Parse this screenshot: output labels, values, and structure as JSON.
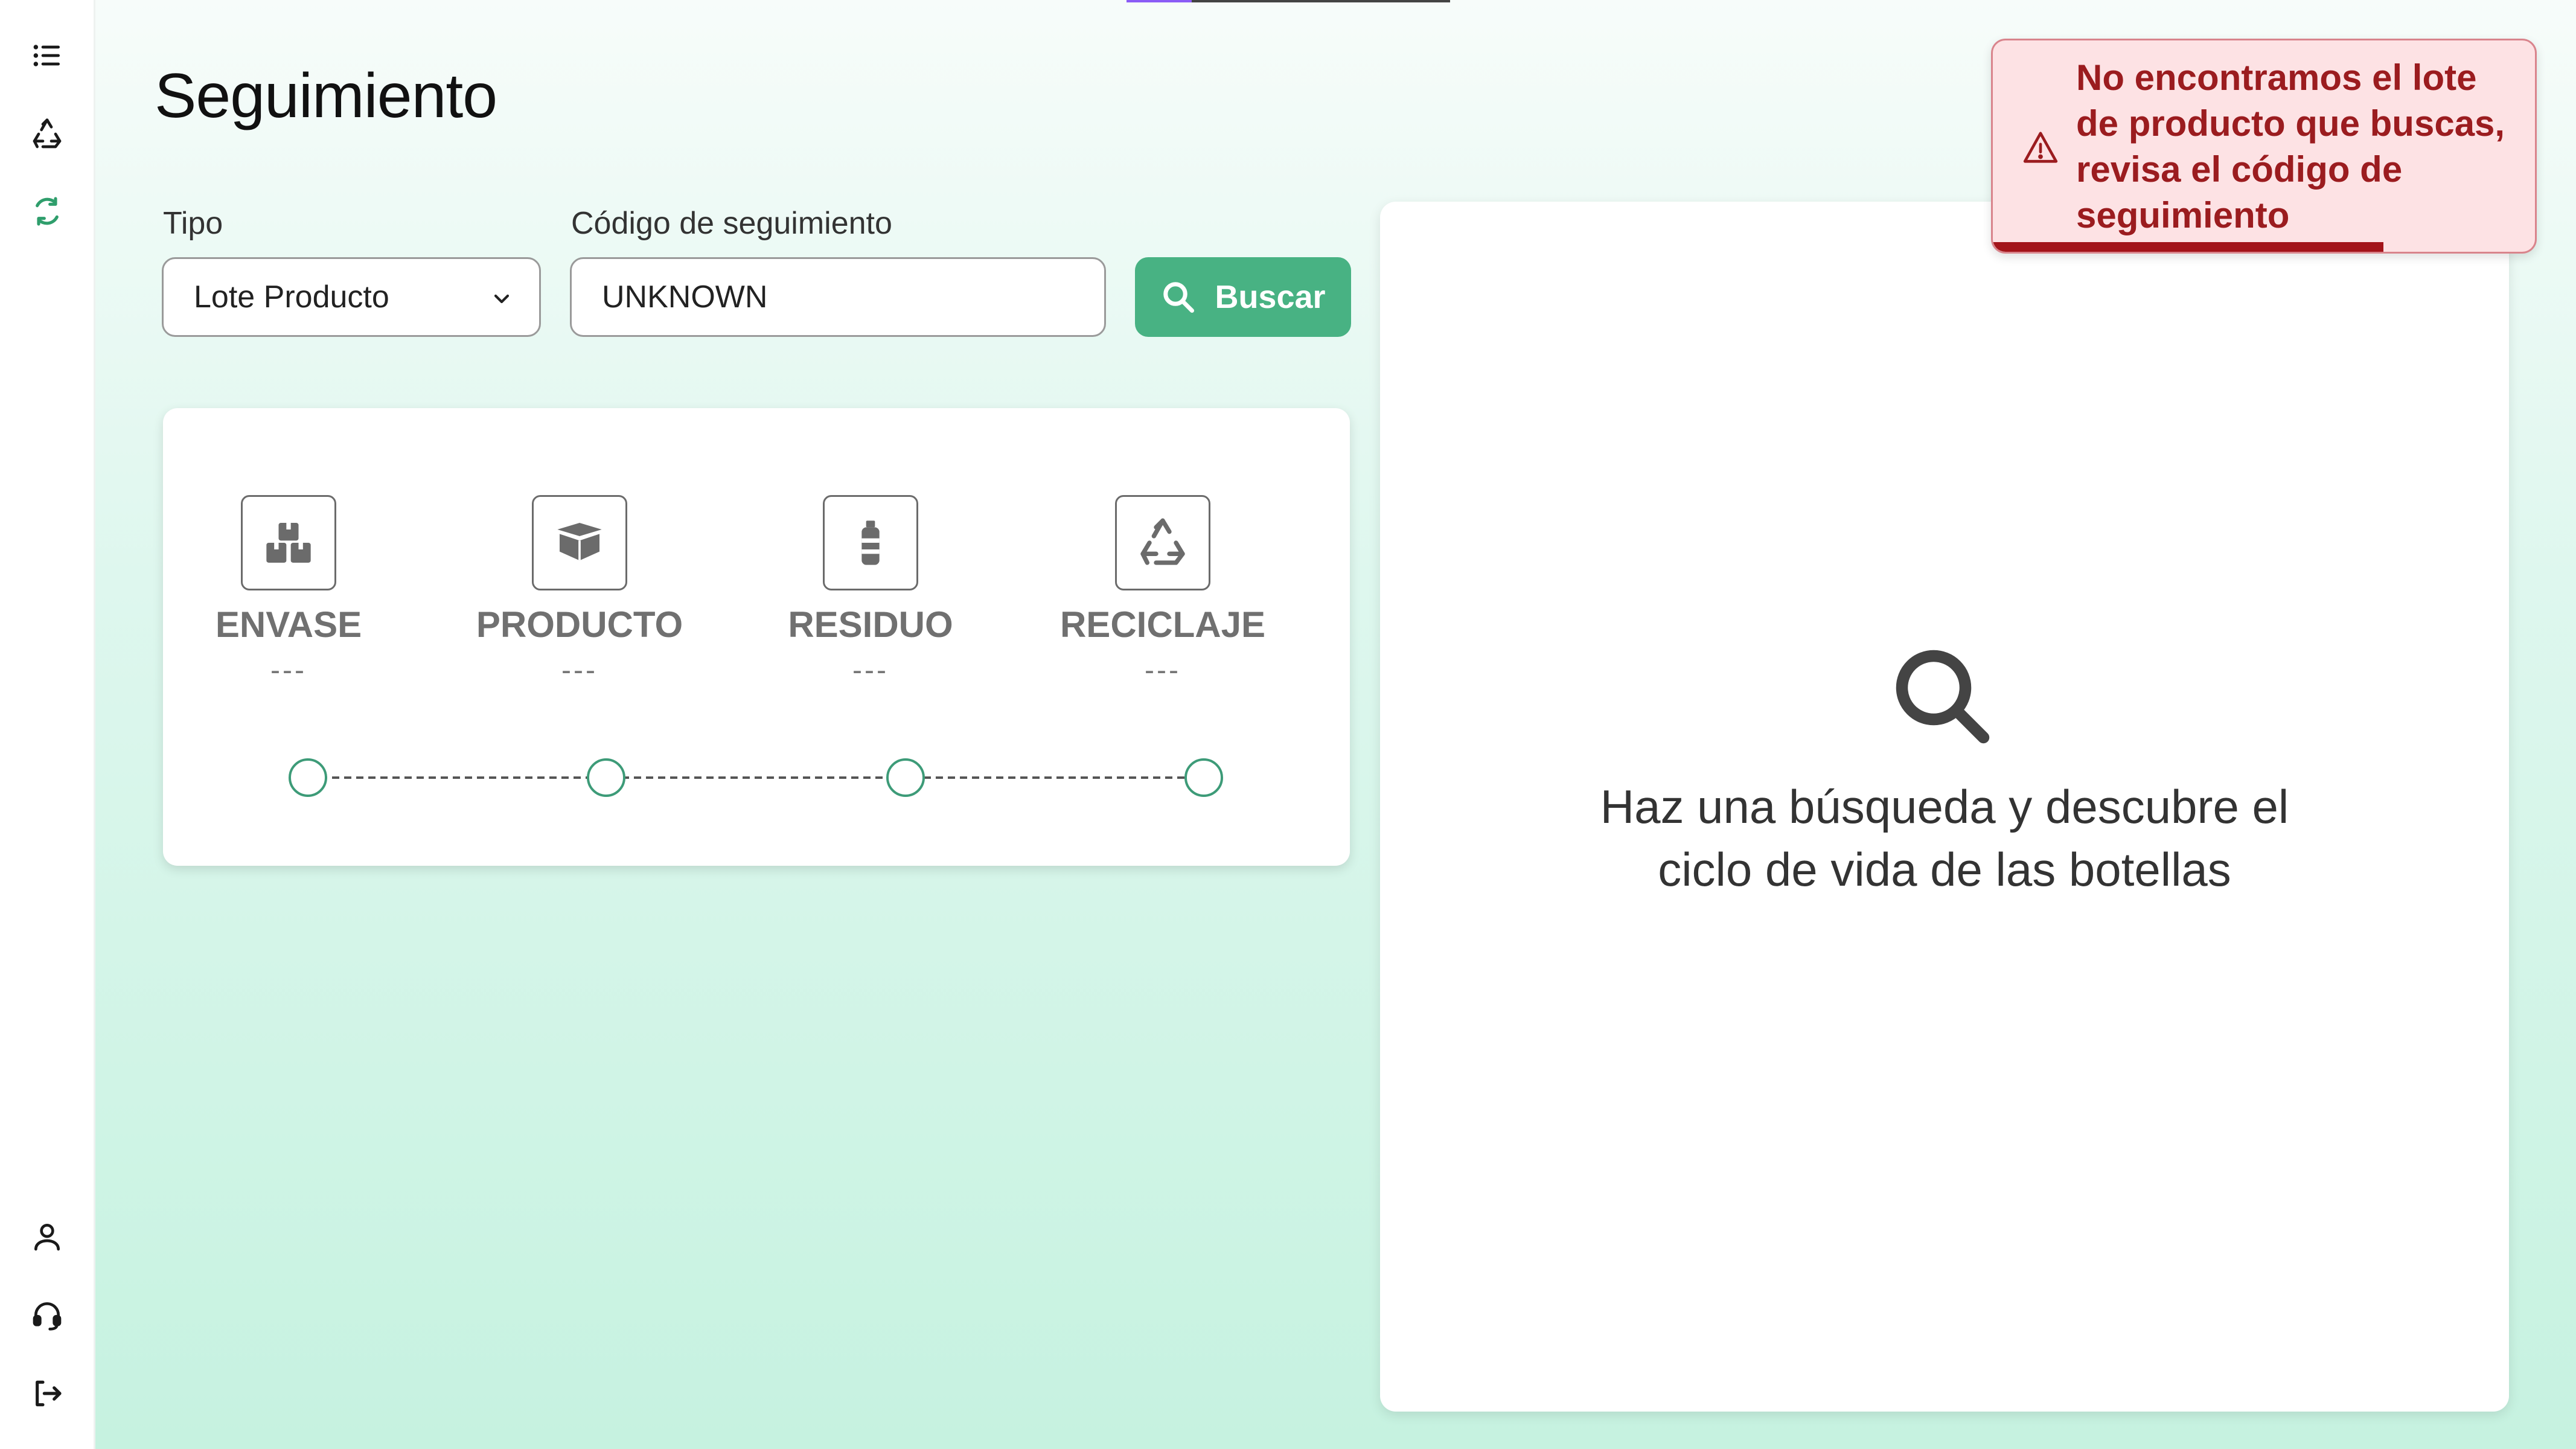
{
  "page": {
    "title": "Seguimiento"
  },
  "sidebar": {
    "top_items": [
      {
        "name": "list-icon"
      },
      {
        "name": "recycle-icon"
      },
      {
        "name": "recycle-active-icon",
        "active": true
      }
    ],
    "bottom_items": [
      {
        "name": "user-icon"
      },
      {
        "name": "headset-icon"
      },
      {
        "name": "logout-icon"
      }
    ]
  },
  "search": {
    "type_label": "Tipo",
    "type_value": "Lote Producto",
    "code_label": "Código de seguimiento",
    "code_value": "UNKNOWN",
    "button_label": "Buscar"
  },
  "stages": [
    {
      "name": "ENVASE",
      "value": "---",
      "icon": "boxes-icon"
    },
    {
      "name": "PRODUCTO",
      "value": "---",
      "icon": "box-open-icon"
    },
    {
      "name": "RESIDUO",
      "value": "---",
      "icon": "bottle-icon"
    },
    {
      "name": "RECICLAJE",
      "value": "---",
      "icon": "recycle-icon"
    }
  ],
  "result": {
    "empty_message": "Haz una búsqueda y descubre el ciclo de vida de las botellas",
    "icon": "search-icon"
  },
  "toast": {
    "message": "No encontramos el lote de producto que buscas, revisa el código de seguimiento",
    "icon": "warning-icon",
    "progress": 0.72
  },
  "colors": {
    "accent": "#48b283",
    "timeline": "#3d9b78",
    "error_text": "#9b1c1f",
    "error_bg": "#fde2e4"
  }
}
